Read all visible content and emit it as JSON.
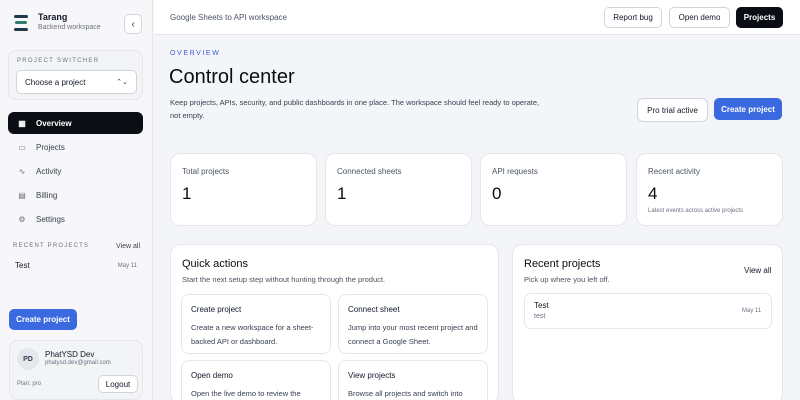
{
  "brand": {
    "name": "Tarang",
    "subtitle": "Backend workspace",
    "collapse_icon": "chevron-left-icon"
  },
  "switcher": {
    "label": "PROJECT SWITCHER",
    "selected": "Choose a project"
  },
  "nav": [
    {
      "label": "Overview",
      "icon": "grid-icon",
      "active": true
    },
    {
      "label": "Projects",
      "icon": "folder-icon",
      "active": false
    },
    {
      "label": "Activity",
      "icon": "activity-icon",
      "active": false
    },
    {
      "label": "Billing",
      "icon": "card-icon",
      "active": false
    },
    {
      "label": "Settings",
      "icon": "gear-icon",
      "active": false
    }
  ],
  "sidebar_recent": {
    "label": "RECENT PROJECTS",
    "view_all": "View all",
    "items": [
      {
        "name": "Test",
        "date": "May 11"
      }
    ]
  },
  "sidebar_create": "Create project",
  "user": {
    "initials": "PD",
    "name": "PhatYSD Dev",
    "email": "phatysd.dev@gmail.com",
    "plan": "Plan: pro",
    "logout": "Logout"
  },
  "topbar": {
    "crumb": "Google Sheets to API workspace",
    "report_bug": "Report bug",
    "open_demo": "Open demo",
    "projects": "Projects"
  },
  "header": {
    "overline": "OVERVIEW",
    "title": "Control center",
    "description": "Keep projects, APIs, security, and public dashboards in one place. The workspace should feel ready to operate, not empty.",
    "trial": "Pro trial active",
    "create": "Create project"
  },
  "stats": [
    {
      "label": "Total projects",
      "value": "1",
      "note": ""
    },
    {
      "label": "Connected sheets",
      "value": "1",
      "note": ""
    },
    {
      "label": "API requests",
      "value": "0",
      "note": ""
    },
    {
      "label": "Recent activity",
      "value": "4",
      "note": "Latest events across active projects"
    }
  ],
  "quick_actions": {
    "title": "Quick actions",
    "subtitle": "Start the next setup step without hunting through the product.",
    "cards": [
      {
        "title": "Create project",
        "desc": "Create a new workspace for a sheet-backed API or dashboard."
      },
      {
        "title": "Connect sheet",
        "desc": "Jump into your most recent project and connect a Google Sheet."
      },
      {
        "title": "Open demo",
        "desc": "Open the live demo to review the"
      },
      {
        "title": "View projects",
        "desc": "Browse all projects and switch into"
      }
    ]
  },
  "recent_projects": {
    "title": "Recent projects",
    "subtitle": "Pick up where you left off.",
    "view_all": "View all",
    "items": [
      {
        "name": "Test",
        "slug": "test",
        "date": "May 11"
      }
    ]
  },
  "colors": {
    "accent": "#3b6ae0",
    "dark": "#0b0d14",
    "overline": "#3b5bdb"
  }
}
